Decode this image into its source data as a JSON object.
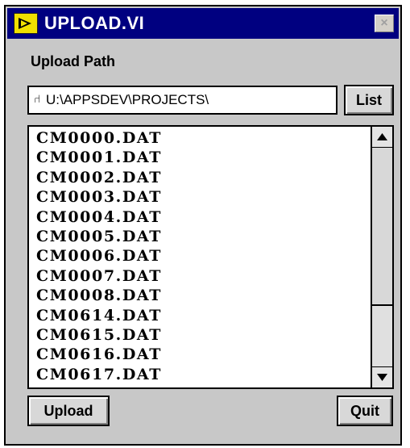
{
  "window": {
    "title": "UPLOAD.VI",
    "close_symbol": "×",
    "icon": "labview-vi-icon"
  },
  "upload_path": {
    "label": "Upload Path",
    "path_icon": "path-icon",
    "path_icon_glyph": "⑁",
    "value": "U:\\APPSDEV\\PROJECTS\\"
  },
  "buttons": {
    "list": "List",
    "upload": "Upload",
    "quit": "Quit"
  },
  "file_list": {
    "items": [
      "CM0000.DAT",
      "CM0001.DAT",
      "CM0002.DAT",
      "CM0003.DAT",
      "CM0004.DAT",
      "CM0005.DAT",
      "CM0006.DAT",
      "CM0007.DAT",
      "CM0008.DAT",
      "CM0614.DAT",
      "CM0615.DAT",
      "CM0616.DAT",
      "CM0617.DAT"
    ],
    "scroll_position": 0.0
  },
  "colors": {
    "titlebar": "#000080",
    "panel": "#c8c8c8",
    "icon_yellow": "#f0e000"
  }
}
